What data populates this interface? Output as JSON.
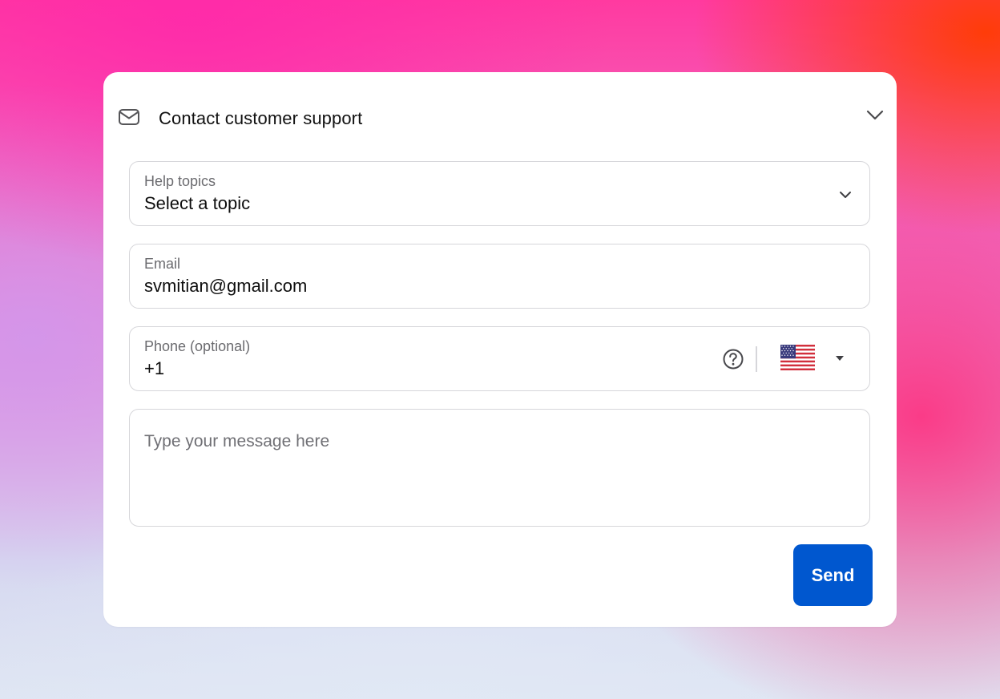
{
  "header": {
    "title": "Contact customer support",
    "icon": "mail-icon",
    "collapse_icon": "chevron-up-icon"
  },
  "form": {
    "topic": {
      "label": "Help topics",
      "value": "Select a topic",
      "icon": "chevron-down-icon"
    },
    "email": {
      "label": "Email",
      "value": "svmitian@gmail.com"
    },
    "phone": {
      "label": "Phone (optional)",
      "value": "+1",
      "help_icon": "question-circle-icon",
      "country_flag": "us-flag-icon",
      "country_caret": "caret-down-icon"
    },
    "message": {
      "placeholder": "Type your message here"
    },
    "send_label": "Send"
  },
  "colors": {
    "accent": "#0057cf",
    "card_bg": "#ffffff",
    "border": "#d6d6da",
    "label_text": "#6b6b6f"
  }
}
